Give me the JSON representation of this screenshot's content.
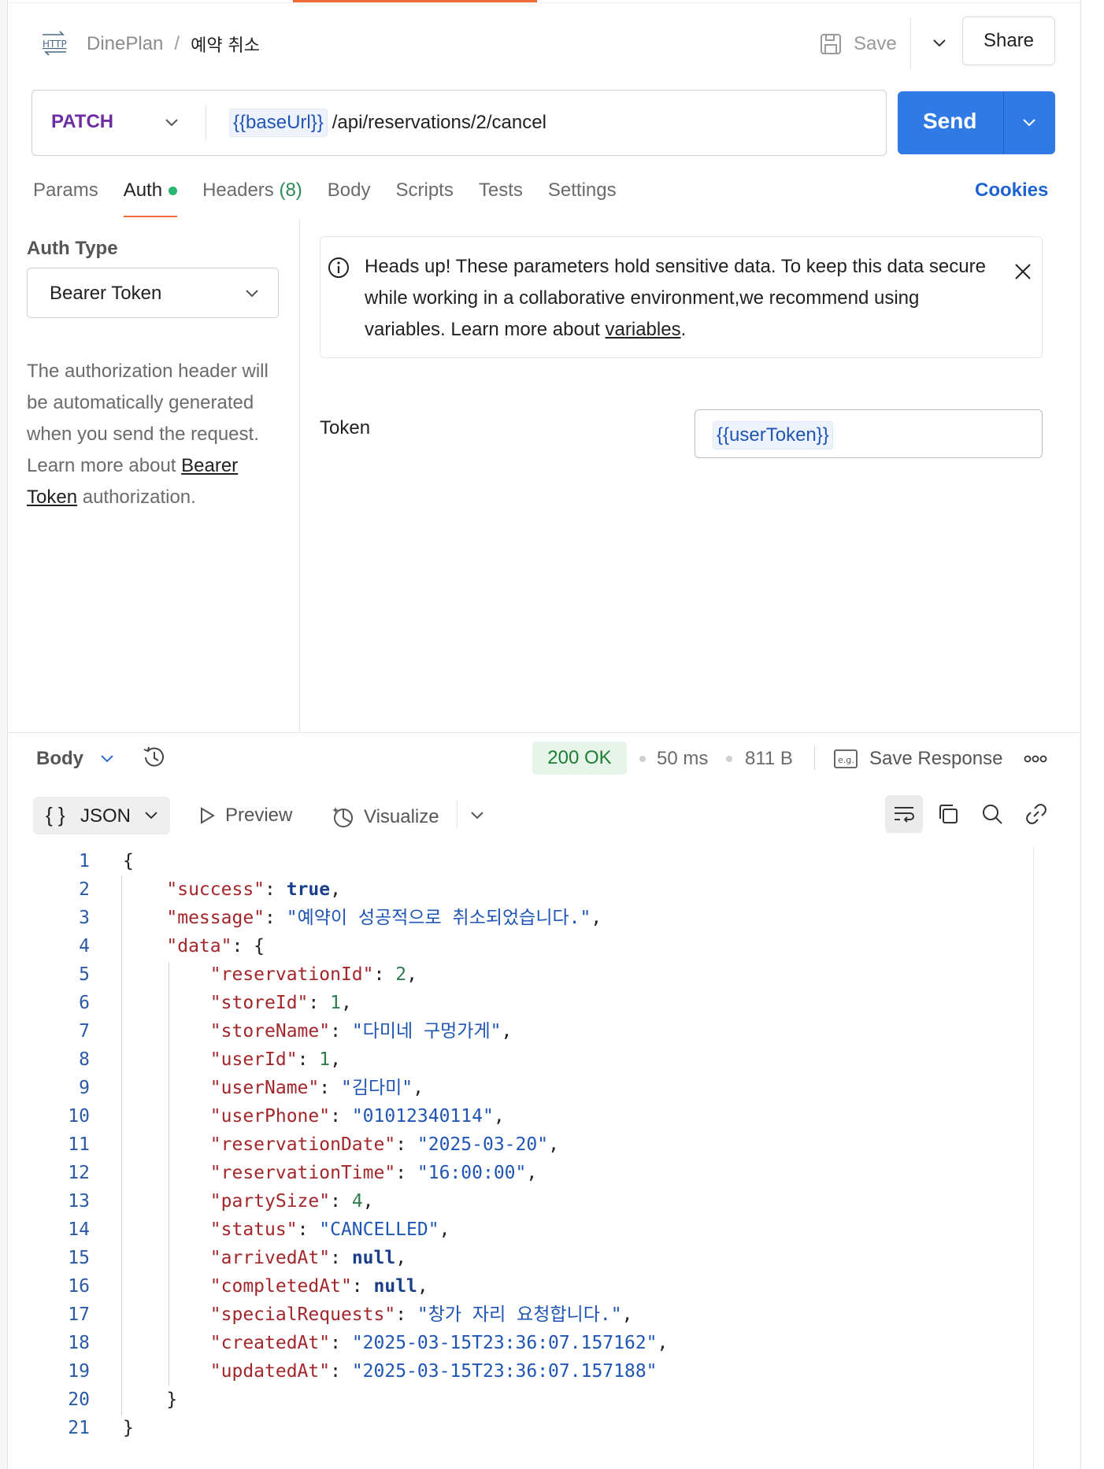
{
  "header": {
    "http_icon_label": "HTTP",
    "collection": "DinePlan",
    "separator": "/",
    "request_name": "예약 취소",
    "save_label": "Save",
    "share_label": "Share"
  },
  "request": {
    "method": "PATCH",
    "url_variable": "{{baseUrl}}",
    "url_path": "/api/reservations/2/cancel",
    "send_label": "Send"
  },
  "tabs": {
    "params": "Params",
    "auth": "Auth",
    "headers": "Headers",
    "headers_count": "(8)",
    "body": "Body",
    "scripts": "Scripts",
    "tests": "Tests",
    "settings": "Settings",
    "cookies": "Cookies"
  },
  "auth": {
    "type_label": "Auth Type",
    "type_value": "Bearer Token",
    "desc_before": "The authorization header will be automatically generated when you send the request. Learn more about ",
    "desc_link": "Bearer Token",
    "desc_after": " authorization.",
    "notice_before": "Heads up! These parameters hold sensitive data. To keep this data secure while working in a collaborative environment,we recommend using variables. Learn more about ",
    "notice_link": "variables",
    "notice_after": ".",
    "token_label": "Token",
    "token_value": "{{userToken}}"
  },
  "response": {
    "body_label": "Body",
    "status": "200 OK",
    "time": "50 ms",
    "size": "811 B",
    "save_response": "Save Response",
    "format": "JSON",
    "format_braces": "{ }",
    "preview": "Preview",
    "visualize": "Visualize",
    "status_color": "#1e7e34"
  },
  "code_lines": [
    {
      "n": "1",
      "t": [
        [
          "p",
          "{"
        ]
      ]
    },
    {
      "n": "2",
      "t": [
        [
          "p",
          "    "
        ],
        [
          "k",
          "\"success\""
        ],
        [
          "p",
          ": "
        ],
        [
          "b",
          "true"
        ],
        [
          "p",
          ","
        ]
      ]
    },
    {
      "n": "3",
      "t": [
        [
          "p",
          "    "
        ],
        [
          "k",
          "\"message\""
        ],
        [
          "p",
          ": "
        ],
        [
          "s",
          "\"예약이 성공적으로 취소되었습니다.\""
        ],
        [
          "p",
          ","
        ]
      ]
    },
    {
      "n": "4",
      "t": [
        [
          "p",
          "    "
        ],
        [
          "k",
          "\"data\""
        ],
        [
          "p",
          ": {"
        ]
      ]
    },
    {
      "n": "5",
      "t": [
        [
          "p",
          "        "
        ],
        [
          "k",
          "\"reservationId\""
        ],
        [
          "p",
          ": "
        ],
        [
          "n",
          "2"
        ],
        [
          "p",
          ","
        ]
      ]
    },
    {
      "n": "6",
      "t": [
        [
          "p",
          "        "
        ],
        [
          "k",
          "\"storeId\""
        ],
        [
          "p",
          ": "
        ],
        [
          "n",
          "1"
        ],
        [
          "p",
          ","
        ]
      ]
    },
    {
      "n": "7",
      "t": [
        [
          "p",
          "        "
        ],
        [
          "k",
          "\"storeName\""
        ],
        [
          "p",
          ": "
        ],
        [
          "s",
          "\"다미네 구멍가게\""
        ],
        [
          "p",
          ","
        ]
      ]
    },
    {
      "n": "8",
      "t": [
        [
          "p",
          "        "
        ],
        [
          "k",
          "\"userId\""
        ],
        [
          "p",
          ": "
        ],
        [
          "n",
          "1"
        ],
        [
          "p",
          ","
        ]
      ]
    },
    {
      "n": "9",
      "t": [
        [
          "p",
          "        "
        ],
        [
          "k",
          "\"userName\""
        ],
        [
          "p",
          ": "
        ],
        [
          "s",
          "\"김다미\""
        ],
        [
          "p",
          ","
        ]
      ]
    },
    {
      "n": "10",
      "t": [
        [
          "p",
          "        "
        ],
        [
          "k",
          "\"userPhone\""
        ],
        [
          "p",
          ": "
        ],
        [
          "s",
          "\"01012340114\""
        ],
        [
          "p",
          ","
        ]
      ]
    },
    {
      "n": "11",
      "t": [
        [
          "p",
          "        "
        ],
        [
          "k",
          "\"reservationDate\""
        ],
        [
          "p",
          ": "
        ],
        [
          "s",
          "\"2025-03-20\""
        ],
        [
          "p",
          ","
        ]
      ]
    },
    {
      "n": "12",
      "t": [
        [
          "p",
          "        "
        ],
        [
          "k",
          "\"reservationTime\""
        ],
        [
          "p",
          ": "
        ],
        [
          "s",
          "\"16:00:00\""
        ],
        [
          "p",
          ","
        ]
      ]
    },
    {
      "n": "13",
      "t": [
        [
          "p",
          "        "
        ],
        [
          "k",
          "\"partySize\""
        ],
        [
          "p",
          ": "
        ],
        [
          "n",
          "4"
        ],
        [
          "p",
          ","
        ]
      ]
    },
    {
      "n": "14",
      "t": [
        [
          "p",
          "        "
        ],
        [
          "k",
          "\"status\""
        ],
        [
          "p",
          ": "
        ],
        [
          "s",
          "\"CANCELLED\""
        ],
        [
          "p",
          ","
        ]
      ]
    },
    {
      "n": "15",
      "t": [
        [
          "p",
          "        "
        ],
        [
          "k",
          "\"arrivedAt\""
        ],
        [
          "p",
          ": "
        ],
        [
          "b",
          "null"
        ],
        [
          "p",
          ","
        ]
      ]
    },
    {
      "n": "16",
      "t": [
        [
          "p",
          "        "
        ],
        [
          "k",
          "\"completedAt\""
        ],
        [
          "p",
          ": "
        ],
        [
          "b",
          "null"
        ],
        [
          "p",
          ","
        ]
      ]
    },
    {
      "n": "17",
      "t": [
        [
          "p",
          "        "
        ],
        [
          "k",
          "\"specialRequests\""
        ],
        [
          "p",
          ": "
        ],
        [
          "s",
          "\"창가 자리 요청합니다.\""
        ],
        [
          "p",
          ","
        ]
      ]
    },
    {
      "n": "18",
      "t": [
        [
          "p",
          "        "
        ],
        [
          "k",
          "\"createdAt\""
        ],
        [
          "p",
          ": "
        ],
        [
          "s",
          "\"2025-03-15T23:36:07.157162\""
        ],
        [
          "p",
          ","
        ]
      ]
    },
    {
      "n": "19",
      "t": [
        [
          "p",
          "        "
        ],
        [
          "k",
          "\"updatedAt\""
        ],
        [
          "p",
          ": "
        ],
        [
          "s",
          "\"2025-03-15T23:36:07.157188\""
        ]
      ]
    },
    {
      "n": "20",
      "t": [
        [
          "p",
          "    }"
        ]
      ]
    },
    {
      "n": "21",
      "t": [
        [
          "p",
          "}"
        ]
      ]
    }
  ],
  "colors": {
    "accent": "#f26b3a",
    "send": "#2f7ae5",
    "method": "#6b2fa3",
    "link": "#1f62d4"
  },
  "icons": [
    "http-icon",
    "save-icon",
    "chevron-down-icon",
    "info-icon",
    "close-icon",
    "history-icon",
    "example-icon",
    "more-icon",
    "play-icon",
    "visualize-icon",
    "wrap-icon",
    "copy-icon",
    "search-icon",
    "link-icon"
  ]
}
